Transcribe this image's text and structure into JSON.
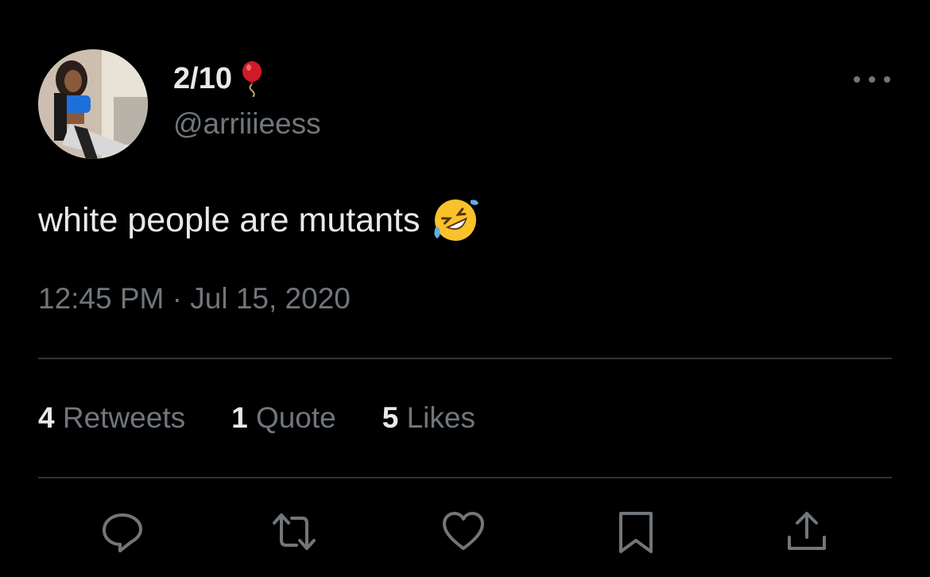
{
  "tweet": {
    "display_name": "2/10",
    "handle": "@arriiieess",
    "text": "white people are mutants",
    "timestamp": "12:45 PM · Jul 15, 2020",
    "emoji": "rolling-on-floor-laughing",
    "name_icon": "balloon"
  },
  "stats": [
    {
      "count": "4",
      "label": "Retweets"
    },
    {
      "count": "1",
      "label": "Quote"
    },
    {
      "count": "5",
      "label": "Likes"
    }
  ],
  "actions": [
    "reply-icon",
    "retweet-icon",
    "like-icon",
    "bookmark-icon",
    "share-icon"
  ],
  "colors": {
    "background": "#000000",
    "primary_text": "#e7e9ea",
    "secondary_text": "#71767b",
    "divider": "#2f3336"
  }
}
